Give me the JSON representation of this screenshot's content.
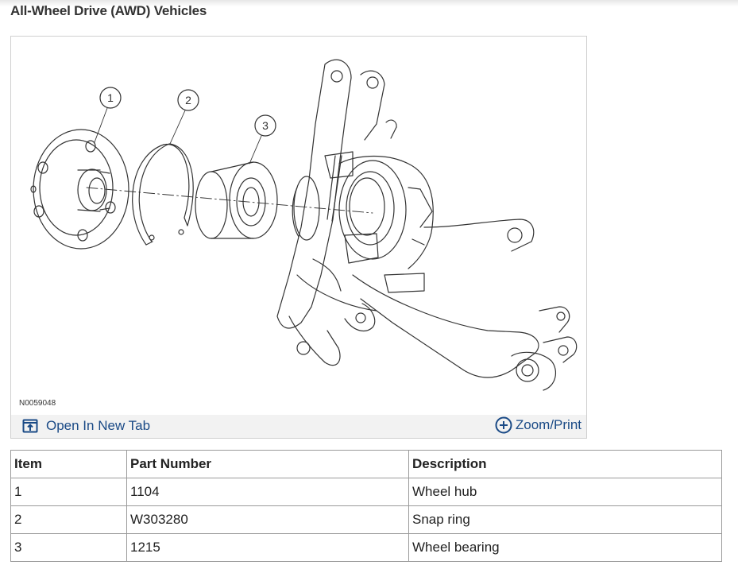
{
  "page": {
    "heading": "All-Wheel Drive (AWD) Vehicles"
  },
  "figure": {
    "code": "N0059048",
    "callouts": [
      "1",
      "2",
      "3"
    ],
    "open_tab_label": "Open In New Tab",
    "zoom_label": "Zoom/Print",
    "icons": {
      "open_tab": "open-new-tab-icon",
      "zoom": "zoom-plus-icon"
    },
    "link_color": "#1a4a86"
  },
  "table": {
    "headers": [
      "Item",
      "Part Number",
      "Description"
    ],
    "rows": [
      [
        "1",
        "1104",
        "Wheel hub"
      ],
      [
        "2",
        "W303280",
        "Snap ring"
      ],
      [
        "3",
        "1215",
        "Wheel bearing"
      ]
    ]
  }
}
